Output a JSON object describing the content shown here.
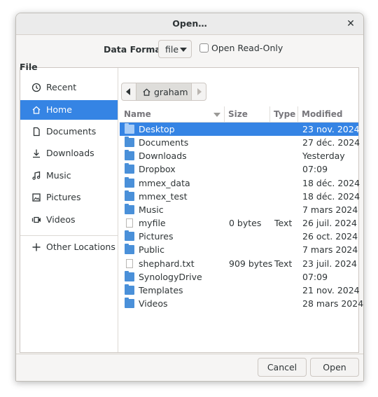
{
  "window": {
    "title": "Open…"
  },
  "format": {
    "label": "Data Format",
    "value": "file",
    "readonly_label": "Open Read-Only"
  },
  "file_label": "File",
  "sidebar": {
    "items": [
      {
        "label": "Recent",
        "icon": "clock-icon"
      },
      {
        "label": "Home",
        "icon": "home-icon",
        "active": true
      },
      {
        "label": "Documents",
        "icon": "document-icon"
      },
      {
        "label": "Downloads",
        "icon": "download-icon"
      },
      {
        "label": "Music",
        "icon": "music-icon"
      },
      {
        "label": "Pictures",
        "icon": "pictures-icon"
      },
      {
        "label": "Videos",
        "icon": "video-icon"
      },
      {
        "label": "Other Locations",
        "icon": "plus-icon"
      }
    ]
  },
  "pathbar": {
    "current": "graham"
  },
  "columns": {
    "name": "Name",
    "size": "Size",
    "type": "Type",
    "modified": "Modified"
  },
  "files": [
    {
      "name": "Desktop",
      "size": "",
      "type": "",
      "modified": "23 nov. 2024",
      "kind": "folder",
      "selected": true
    },
    {
      "name": "Documents",
      "size": "",
      "type": "",
      "modified": "27 déc. 2024",
      "kind": "folder"
    },
    {
      "name": "Downloads",
      "size": "",
      "type": "",
      "modified": "Yesterday",
      "kind": "folder"
    },
    {
      "name": "Dropbox",
      "size": "",
      "type": "",
      "modified": "07:09",
      "kind": "folder"
    },
    {
      "name": "mmex_data",
      "size": "",
      "type": "",
      "modified": "18 déc. 2024",
      "kind": "folder"
    },
    {
      "name": "mmex_test",
      "size": "",
      "type": "",
      "modified": "18 déc. 2024",
      "kind": "folder"
    },
    {
      "name": "Music",
      "size": "",
      "type": "",
      "modified": "7 mars 2024",
      "kind": "folder"
    },
    {
      "name": "myfile",
      "size": "0 bytes",
      "type": "Text",
      "modified": "26 juil. 2024",
      "kind": "file"
    },
    {
      "name": "Pictures",
      "size": "",
      "type": "",
      "modified": "26 oct. 2024",
      "kind": "folder"
    },
    {
      "name": "Public",
      "size": "",
      "type": "",
      "modified": "7 mars 2024",
      "kind": "folder"
    },
    {
      "name": "shephard.txt",
      "size": "909 bytes",
      "type": "Text",
      "modified": "23 juil. 2024",
      "kind": "file"
    },
    {
      "name": "SynologyDrive",
      "size": "",
      "type": "",
      "modified": "07:09",
      "kind": "folder"
    },
    {
      "name": "Templates",
      "size": "",
      "type": "",
      "modified": "21 nov. 2024",
      "kind": "folder"
    },
    {
      "name": "Videos",
      "size": "",
      "type": "",
      "modified": "28 mars 2024",
      "kind": "folder"
    }
  ],
  "buttons": {
    "cancel": "Cancel",
    "open": "Open"
  },
  "colors": {
    "accent": "#3584e4",
    "folder": "#4a90d9"
  }
}
